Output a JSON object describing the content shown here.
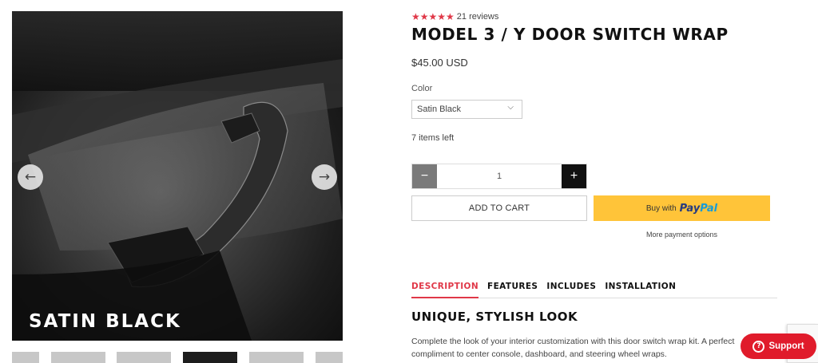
{
  "gallery": {
    "caption": "SATIN BLACK",
    "prev_arrow": "←",
    "next_arrow": "→",
    "thumbnail_count": 6,
    "active_thumbnail_index": 3
  },
  "product": {
    "rating_stars": "★★★★★",
    "rating": 5,
    "reviews_text": "21 reviews",
    "title": "MODEL 3 / Y DOOR SWITCH WRAP",
    "price": "$45.00 USD",
    "color_label": "Color",
    "color_selected": "Satin Black",
    "stock_text": "7 items left",
    "quantity": "1",
    "minus_symbol": "−",
    "plus_symbol": "+",
    "add_to_cart": "ADD TO CART",
    "paypal_prefix": "Buy with",
    "paypal_brand_1": "Pay",
    "paypal_brand_2": "Pal",
    "more_payment": "More payment options"
  },
  "tabs": [
    {
      "label": "DESCRIPTION",
      "active": true
    },
    {
      "label": "FEATURES",
      "active": false
    },
    {
      "label": "INCLUDES",
      "active": false
    },
    {
      "label": "INSTALLATION",
      "active": false
    }
  ],
  "description": {
    "heading": "UNIQUE, STYLISH LOOK",
    "body": "Complete the look of your interior customization with this door switch wrap kit. A perfect compliment to center console, dashboard, and steering wheel wraps."
  },
  "support": {
    "icon": "?",
    "label": "Support"
  },
  "colors": {
    "accent": "#e03848",
    "paypal_yellow": "#ffc439",
    "support_red": "#e01b2b"
  }
}
